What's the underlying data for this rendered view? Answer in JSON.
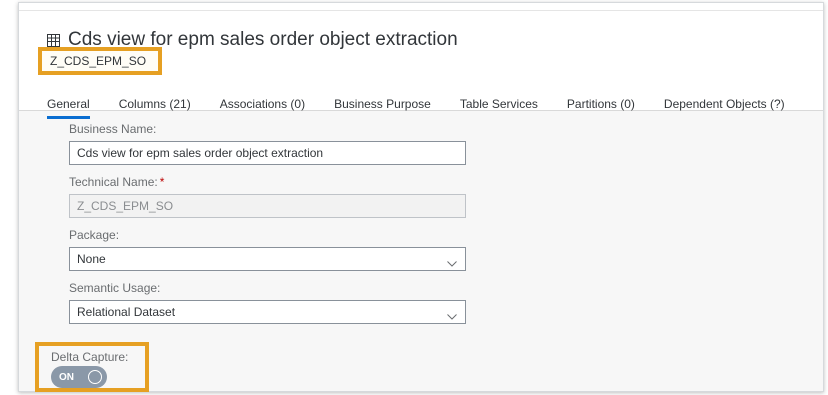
{
  "header": {
    "title": "Cds view for epm sales order object extraction",
    "technical_id": "Z_CDS_EPM_SO",
    "icon": "table-icon"
  },
  "tabs": [
    {
      "label": "General",
      "active": true
    },
    {
      "label": "Columns (21)",
      "active": false
    },
    {
      "label": "Associations (0)",
      "active": false
    },
    {
      "label": "Business Purpose",
      "active": false
    },
    {
      "label": "Table Services",
      "active": false
    },
    {
      "label": "Partitions (0)",
      "active": false
    },
    {
      "label": "Dependent Objects (?)",
      "active": false
    }
  ],
  "form": {
    "business_name_label": "Business Name:",
    "business_name_value": "Cds view for epm sales order object extraction",
    "technical_name_label": "Technical Name:",
    "technical_name_required": "*",
    "technical_name_value": "Z_CDS_EPM_SO",
    "package_label": "Package:",
    "package_value": "None",
    "semantic_usage_label": "Semantic Usage:",
    "semantic_usage_value": "Relational Dataset",
    "delta_capture_label": "Delta Capture:",
    "delta_capture_state": "ON"
  },
  "colors": {
    "highlight": "#e6a023",
    "active_tab": "#0a6ed1",
    "toggle_bg": "#8a98a8",
    "required": "#bb0000"
  }
}
